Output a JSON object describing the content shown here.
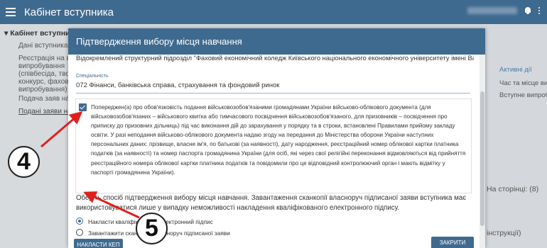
{
  "app": {
    "title": "Кабінет вступника"
  },
  "sidebar": {
    "head": "▾ Кабінет вступника",
    "items": [
      {
        "label": "Дані вступника"
      },
      {
        "label": "Реєстрація на вступ"
      },
      {
        "label": "випробування"
      },
      {
        "label": "(співбесіда, творч"
      },
      {
        "label": "конкурс, фахове"
      },
      {
        "label": "випробування)"
      },
      {
        "label": "Подача заяв на"
      },
      {
        "label": "Подані заяви на"
      }
    ]
  },
  "background_right": {
    "active": "Активні дії",
    "col_header": "Час та місце вип",
    "row_value": "Вступне випробу",
    "per_page": "На сторінці: (8)",
    "instructions": "інструкції)"
  },
  "modal": {
    "title": "Підтвердження вибору місця навчання",
    "institution": "Відокремлений структурний підрозділ \"Фаховий економічний коледж Київського національного економічного університету імені Вадима Гетьмана\"",
    "specialty_label": "Спеціальність",
    "specialty_value": "072 Фінанси, банківська справа, страхування та фондовий ринок",
    "consent_text": "Попереджен(а) про обов'язковість подання військовозобов'язаними громадянами України військово-облікового документа (для військовозобов'язаних – військового квитка або тимчасового посвідчення військовозобов'язаного, для призовників – посвідчення про приписку до призовних дільниць) під час виконання дій до зарахування у порядку та в строки, встановлені Правилами прийому закладу освіти. У разі неподання військово-облікового документа надаю згоду на передання до Міністерства оборони України наступних персональних даних: прізвище, власне ім'я, по батькові (за наявності), дату народження, реєстраційний номер облікової картки платника податків (за наявності) та номер паспорта громадянина України (для осіб, які через свої релігійні переконання відмовляються від прийняття реєстраційного номера облікової картки платника податків та повідомили про це відповідний контролюючий орган і мають відмітку у паспорті громадянина України).",
    "consent_checked": true,
    "choose_text": "Оберіть спосіб підтвердження вибору місця навчання. Завантаження сканкопії власноруч підписаної заяви вступника має використовуватися лише у випадку неможливості накладення кваліфікованого електронного підпису.",
    "options": [
      {
        "label": "Накласти кваліфікований електронний підпис",
        "selected": true
      },
      {
        "label": "Завантажити сканкопію власноруч підписаної заяви",
        "selected": false
      }
    ],
    "kep_button": "НАКЛАСТИ КЕП",
    "close_button": "ЗАКРИТИ"
  },
  "annotations": {
    "step_4": "4",
    "step_5": "5",
    "arrow_color": "#e0201b"
  },
  "colors": {
    "accent": "#3f6a8f",
    "annotation_red": "#e0201b"
  }
}
